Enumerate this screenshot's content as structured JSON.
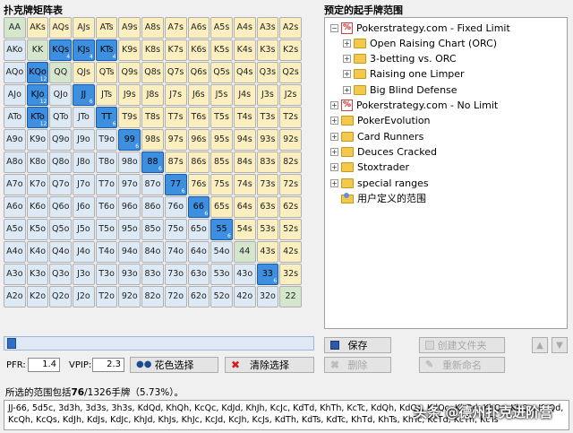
{
  "left_title": "扑克牌矩阵表",
  "right_title": "预定的起手牌范围",
  "grid": {
    "rows": [
      [
        "AA",
        "AKs",
        "AQs",
        "AJs",
        "ATs",
        "A9s",
        "A8s",
        "A7s",
        "A6s",
        "A5s",
        "A4s",
        "A3s",
        "A2s"
      ],
      [
        "AKo",
        "KK",
        "KQs",
        "KJs",
        "KTs",
        "K9s",
        "K8s",
        "K7s",
        "K6s",
        "K5s",
        "K4s",
        "K3s",
        "K2s"
      ],
      [
        "AQo",
        "KQo",
        "QQ",
        "QJs",
        "QTs",
        "Q9s",
        "Q8s",
        "Q7s",
        "Q6s",
        "Q5s",
        "Q4s",
        "Q3s",
        "Q2s"
      ],
      [
        "AJo",
        "KJo",
        "QJo",
        "JJ",
        "JTs",
        "J9s",
        "J8s",
        "J7s",
        "J6s",
        "J5s",
        "J4s",
        "J3s",
        "J2s"
      ],
      [
        "ATo",
        "KTo",
        "QTo",
        "JTo",
        "TT",
        "T9s",
        "T8s",
        "T7s",
        "T6s",
        "T5s",
        "T4s",
        "T3s",
        "T2s"
      ],
      [
        "A9o",
        "K9o",
        "Q9o",
        "J9o",
        "T9o",
        "99",
        "98s",
        "97s",
        "96s",
        "95s",
        "94s",
        "93s",
        "92s"
      ],
      [
        "A8o",
        "K8o",
        "Q8o",
        "J8o",
        "T8o",
        "98o",
        "88",
        "87s",
        "86s",
        "85s",
        "84s",
        "83s",
        "82s"
      ],
      [
        "A7o",
        "K7o",
        "Q7o",
        "J7o",
        "T7o",
        "97o",
        "87o",
        "77",
        "76s",
        "75s",
        "74s",
        "73s",
        "72s"
      ],
      [
        "A6o",
        "K6o",
        "Q6o",
        "J6o",
        "T6o",
        "96o",
        "86o",
        "76o",
        "66",
        "65s",
        "64s",
        "63s",
        "62s"
      ],
      [
        "A5o",
        "K5o",
        "Q5o",
        "J5o",
        "T5o",
        "95o",
        "85o",
        "75o",
        "65o",
        "55",
        "54s",
        "53s",
        "52s"
      ],
      [
        "A4o",
        "K4o",
        "Q4o",
        "J4o",
        "T4o",
        "94o",
        "84o",
        "74o",
        "64o",
        "54o",
        "44",
        "43s",
        "42s"
      ],
      [
        "A3o",
        "K3o",
        "Q3o",
        "J3o",
        "T3o",
        "93o",
        "83o",
        "73o",
        "63o",
        "53o",
        "43o",
        "33",
        "32s"
      ],
      [
        "A2o",
        "K2o",
        "Q2o",
        "J2o",
        "T2o",
        "92o",
        "82o",
        "72o",
        "62o",
        "52o",
        "42o",
        "32o",
        "22"
      ]
    ],
    "selected": {
      "KQs": "4",
      "KJs": "4",
      "KTs": "4",
      "KQo": "12",
      "KJo": "12",
      "KTo": "12",
      "JJ": "6",
      "TT": "6",
      "99": "6",
      "88": "6",
      "77": "6",
      "66": "6",
      "55": "6",
      "33": "6"
    }
  },
  "tree": [
    {
      "label": "Pokerstrategy.com - Fixed Limit",
      "type": "ps",
      "expander": "−",
      "depth": 0
    },
    {
      "label": "Open Raising Chart (ORC)",
      "type": "folder",
      "expander": "+",
      "depth": 1
    },
    {
      "label": "3-betting vs. ORC",
      "type": "folder",
      "expander": "+",
      "depth": 1
    },
    {
      "label": "Raising one Limper",
      "type": "folder",
      "expander": "+",
      "depth": 1
    },
    {
      "label": "Big Blind Defense",
      "type": "folder",
      "expander": "+",
      "depth": 1
    },
    {
      "label": "Pokerstrategy.com - No Limit",
      "type": "ps",
      "expander": "+",
      "depth": 0
    },
    {
      "label": "PokerEvolution",
      "type": "folder",
      "expander": "+",
      "depth": 0
    },
    {
      "label": "Card Runners",
      "type": "folder",
      "expander": "+",
      "depth": 0
    },
    {
      "label": "Deuces Cracked",
      "type": "folder",
      "expander": "+",
      "depth": 0
    },
    {
      "label": "Stoxtrader",
      "type": "folder",
      "expander": "+",
      "depth": 0
    },
    {
      "label": "special ranges",
      "type": "folder",
      "expander": "+",
      "depth": 0
    },
    {
      "label": "用户定义的范围",
      "type": "user",
      "expander": "",
      "depth": 0
    }
  ],
  "controls": {
    "pfr_label": "PFR:",
    "pfr_value": "1.4",
    "vpip_label": "VPIP:",
    "vpip_value": "2.3",
    "suit_select": "花色选择",
    "clear_select": "清除选择",
    "save": "保存",
    "new_folder": "创建文件夹",
    "delete": "删除",
    "rename": "重新命名"
  },
  "summary": {
    "prefix": "所选的范围包括",
    "count": "76",
    "suffix": "/1326手牌（5.73%）。"
  },
  "combos_text": "JJ-66, 5d5c, 3d3h, 3d3s, 3h3s, KdQd, KhQh, KcQc, KdJd, KhJh, KcJc, KdTd, KhTh, KcTc, KdQh, KdQs, KdQc, KhQd, KhQs, KhQc, KcQd, KcQh, KcQs, KdJh, KdJs, KdJc, KhJd, KhJs, KhJc, KcJd, KcJh, KcJs, KdTh, KdTs, KdTc, KhTd, KhTs, KhTc, KcTd, KcTh, KcTs",
  "watermark": "头条 @德州扑克进阶营",
  "colors": {
    "pair": "#d4e6cc",
    "suited": "#fbefbf",
    "offsuit": "#dde9f5",
    "selected": "#3d8fe0"
  }
}
